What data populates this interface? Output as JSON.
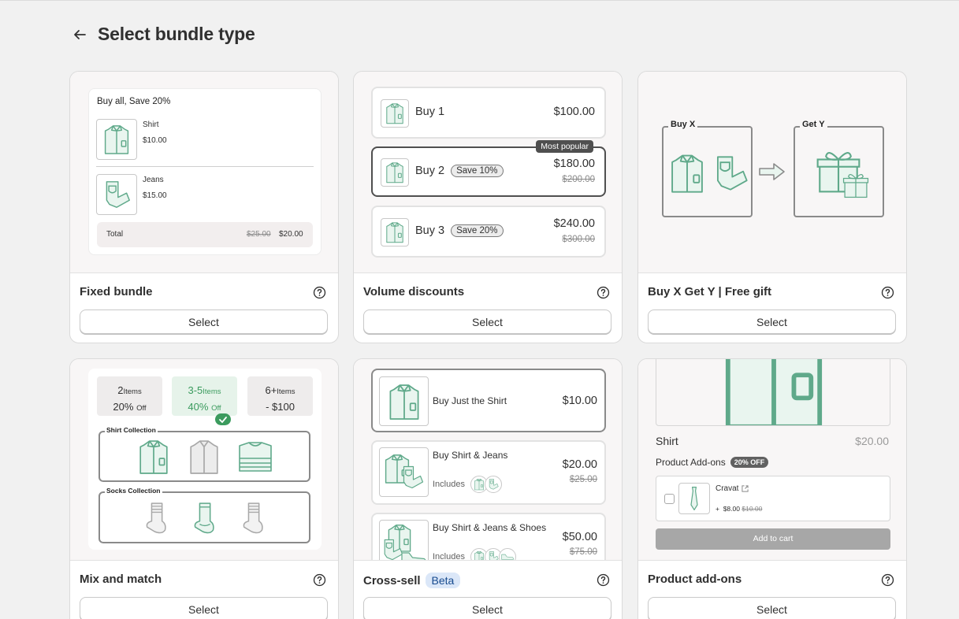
{
  "page": {
    "title": "Select bundle type"
  },
  "cards": {
    "fixed": {
      "title": "Fixed bundle",
      "select": "Select"
    },
    "volume": {
      "title": "Volume discounts",
      "select": "Select"
    },
    "bxgy": {
      "title": "Buy X Get Y | Free gift",
      "select": "Select"
    },
    "mix": {
      "title": "Mix and match",
      "select": "Select"
    },
    "cross": {
      "title": "Cross-sell",
      "badge": "Beta",
      "select": "Select"
    },
    "addons": {
      "title": "Product add-ons",
      "select": "Select"
    }
  },
  "fixed_preview": {
    "heading": "Buy all, Save 20%",
    "items": [
      {
        "name": "Shirt",
        "price": "$10.00"
      },
      {
        "name": "Jeans",
        "price": "$15.00"
      }
    ],
    "total_label": "Total",
    "total_old": "$25.00",
    "total_new": "$20.00"
  },
  "volume_preview": {
    "rows": [
      {
        "label": "Buy 1",
        "save": "",
        "price": "$100.00",
        "old": ""
      },
      {
        "label": "Buy 2",
        "save": "Save 10%",
        "price": "$180.00",
        "old": "$200.00",
        "badge": "Most popular"
      },
      {
        "label": "Buy 3",
        "save": "Save 20%",
        "price": "$240.00",
        "old": "$300.00"
      }
    ]
  },
  "bxgy_preview": {
    "buy": "Buy X",
    "get": "Get Y"
  },
  "mix_preview": {
    "tiers": [
      {
        "count": "2",
        "unit": "Items",
        "deal": "20%",
        "deal_unit": "Off"
      },
      {
        "count": "3-5",
        "unit": "Items",
        "deal": "40%",
        "deal_unit": "Off"
      },
      {
        "count": "6+",
        "unit": "Items",
        "deal": "- $100",
        "deal_unit": ""
      }
    ],
    "collections": [
      "Shirt Collection",
      "Socks Collection"
    ]
  },
  "cross_preview": {
    "rows": [
      {
        "name": "Buy Just the Shirt",
        "price": "$10.00",
        "old": ""
      },
      {
        "name": "Buy Shirt & Jeans",
        "price": "$20.00",
        "old": "$25.00",
        "includes": "Includes"
      },
      {
        "name": "Buy Shirt & Jeans & Shoes",
        "price": "$50.00",
        "old": "$75.00",
        "includes": "Includes"
      }
    ]
  },
  "addons_preview": {
    "product": "Shirt",
    "price": "$20.00",
    "label": "Product Add-ons",
    "badge": "20% OFF",
    "addon_name": "Cravat",
    "addon_prefix": "+",
    "addon_price": "$8.00",
    "addon_old": "$10.00",
    "cart": "Add to cart"
  },
  "colors": {
    "accent_green": "#3b9b5e",
    "icon_green": "#5fa98a",
    "selected_border": "#4f4f4f",
    "beta_bg": "#dbe7f8"
  },
  "icons": [
    "arrow-left-icon",
    "question-circle-icon",
    "shirt-icon",
    "jeans-icon",
    "gift-icon",
    "arrow-right-icon",
    "sock-icon",
    "shoe-icon",
    "tie-icon",
    "check-icon",
    "external-link-icon"
  ]
}
